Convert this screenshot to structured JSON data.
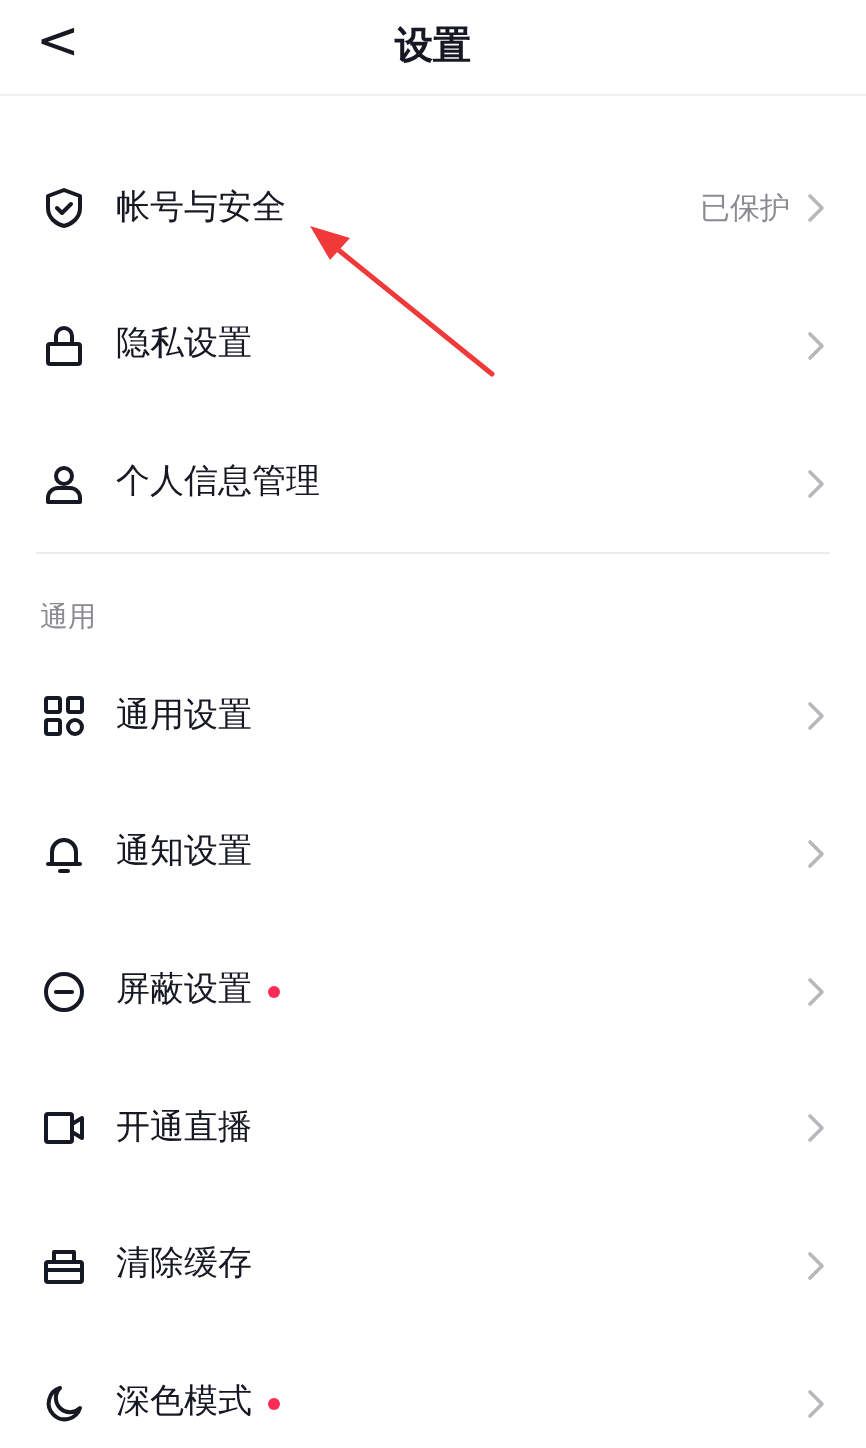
{
  "header": {
    "back": "<",
    "title": "设置"
  },
  "groups": [
    {
      "items": [
        {
          "label": "帐号与安全",
          "value": "已保护",
          "dot": false
        },
        {
          "label": "隐私设置",
          "dot": false
        },
        {
          "label": "个人信息管理",
          "dot": false
        }
      ]
    },
    {
      "title": "通用",
      "items": [
        {
          "label": "通用设置",
          "dot": false
        },
        {
          "label": "通知设置",
          "dot": false
        },
        {
          "label": "屏蔽设置",
          "dot": true
        },
        {
          "label": "开通直播",
          "dot": false
        },
        {
          "label": "清除缓存",
          "dot": false
        },
        {
          "label": "深色模式",
          "dot": true
        }
      ]
    }
  ],
  "annotation": {
    "kind": "arrow"
  }
}
